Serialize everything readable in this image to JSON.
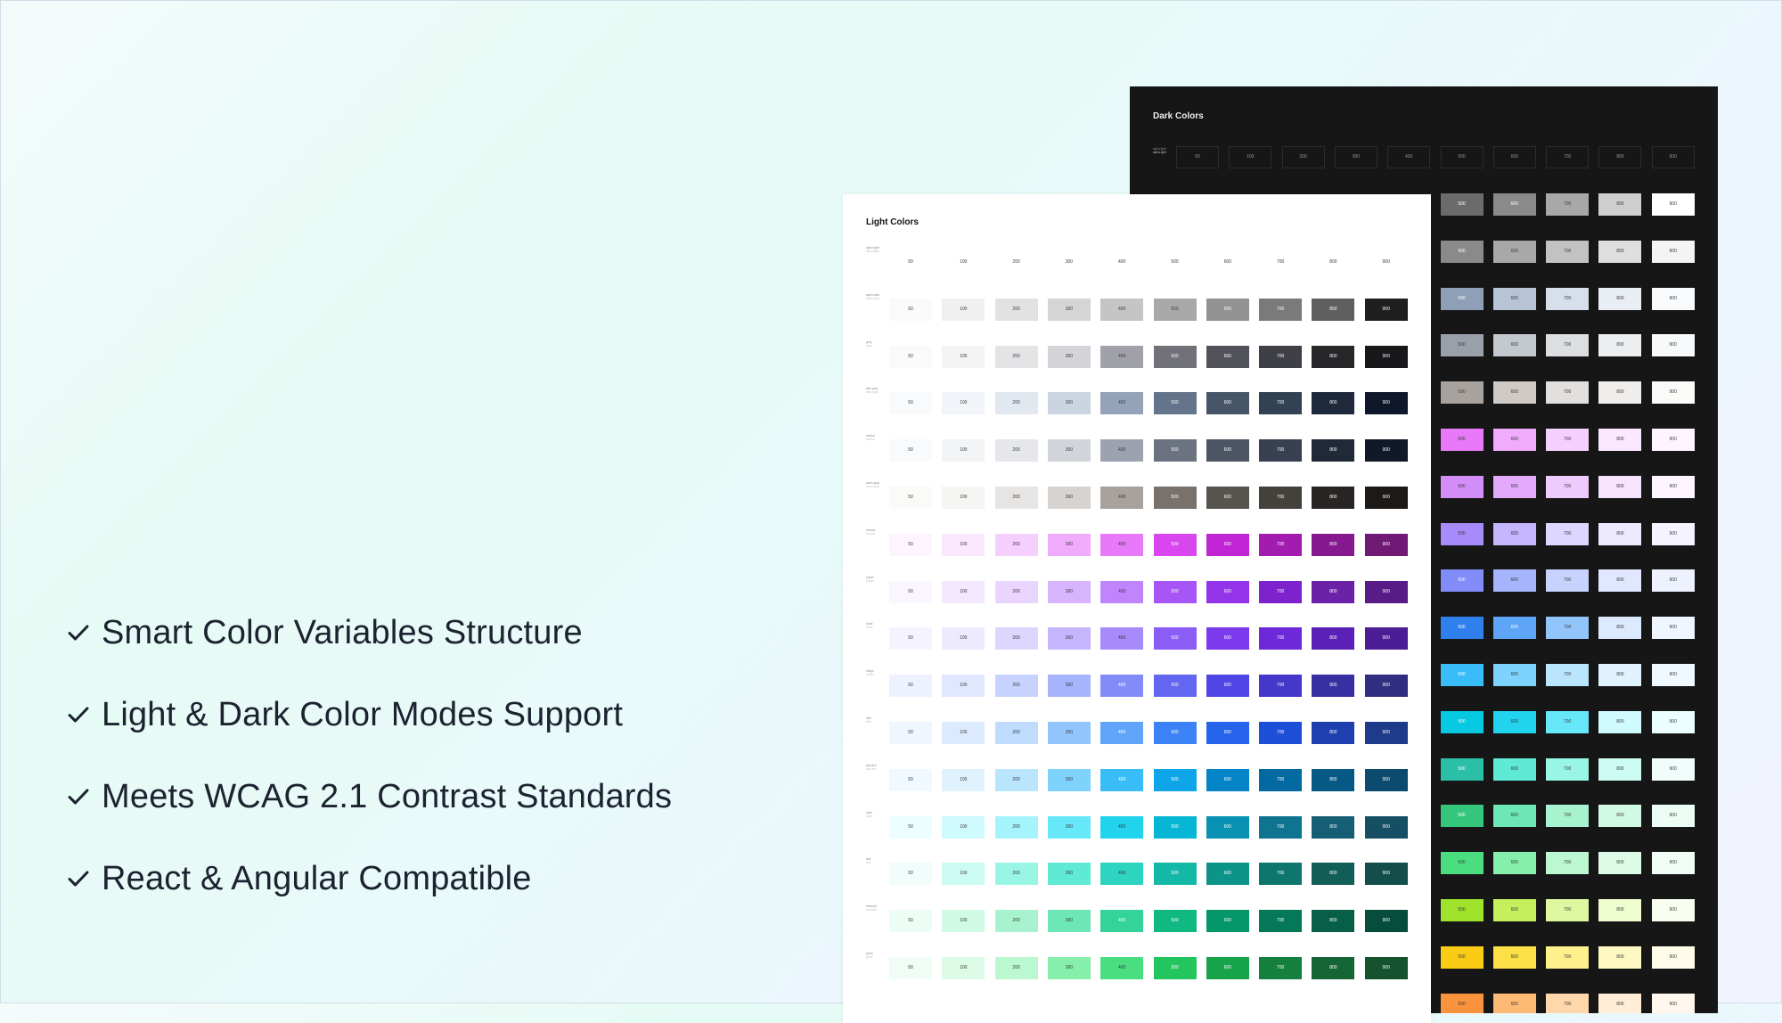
{
  "features": [
    "Smart Color Variables Structure",
    "Light & Dark Color Modes Support",
    "Meets WCAG 2.1 Contrast Standards",
    "React & Angular Compatible"
  ],
  "icons": {
    "feature_icon": "checkmark-icon"
  },
  "colors": {
    "feature_text": "#1c2230",
    "dark_panel_bg": "#161616",
    "light_panel_bg": "#ffffff"
  },
  "light_panel": {
    "title": "Light Colors",
    "rows": [
      {
        "label": "alpha light",
        "sub": "alpha-light",
        "labels": [
          "50",
          "100",
          "200",
          "300",
          "400",
          "500",
          "600",
          "700",
          "800",
          "900"
        ],
        "colors": [
          "#ffffff",
          "#ffffff",
          "#ffffff",
          "#ffffff",
          "#ffffff",
          "#ffffff",
          "#ffffff",
          "#ffffff",
          "#ffffff",
          "#ffffff"
        ]
      },
      {
        "label": "alpha dark",
        "sub": "alpha-dark",
        "labels": [
          "50",
          "100",
          "200",
          "300",
          "400",
          "500",
          "600",
          "700",
          "800",
          "900"
        ],
        "colors": [
          "#fafafa",
          "#f0f0f0",
          "#e2e2e2",
          "#d5d5d5",
          "#c5c5c5",
          "#a9a9a9",
          "#929292",
          "#7a7a7a",
          "#5f5f5f",
          "#1f1f1f"
        ]
      },
      {
        "label": "gray",
        "sub": "gray",
        "labels": [
          "50",
          "100",
          "200",
          "300",
          "400",
          "500",
          "600",
          "700",
          "800",
          "900"
        ],
        "colors": [
          "#fafafa",
          "#f4f4f5",
          "#e4e4e7",
          "#d4d4d8",
          "#a1a1aa",
          "#71717a",
          "#52525b",
          "#3f3f46",
          "#27272a",
          "#18181b"
        ]
      },
      {
        "label": "blue gray",
        "sub": "blue-gray",
        "labels": [
          "50",
          "100",
          "200",
          "300",
          "400",
          "500",
          "600",
          "700",
          "800",
          "900"
        ],
        "colors": [
          "#f8fafc",
          "#f1f5f9",
          "#e2e8f0",
          "#cbd5e1",
          "#94a3b8",
          "#64748b",
          "#475569",
          "#334155",
          "#1e293b",
          "#0f172a"
        ]
      },
      {
        "label": "neutral",
        "sub": "neutral",
        "labels": [
          "50",
          "100",
          "200",
          "300",
          "400",
          "500",
          "600",
          "700",
          "800",
          "900"
        ],
        "colors": [
          "#f9fafb",
          "#f3f4f6",
          "#e5e7eb",
          "#d1d5db",
          "#9ca3af",
          "#6b7280",
          "#4b5563",
          "#374151",
          "#1f2937",
          "#111827"
        ]
      },
      {
        "label": "warm gray",
        "sub": "warm-gray",
        "labels": [
          "50",
          "100",
          "200",
          "300",
          "400",
          "500",
          "600",
          "700",
          "800",
          "900"
        ],
        "colors": [
          "#fafaf9",
          "#f5f5f4",
          "#e7e5e4",
          "#d6d3d1",
          "#a8a29e",
          "#78716c",
          "#57534e",
          "#44403c",
          "#292524",
          "#1c1917"
        ]
      },
      {
        "label": "fuchsia",
        "sub": "fuchsia",
        "labels": [
          "50",
          "100",
          "200",
          "300",
          "400",
          "500",
          "600",
          "700",
          "800",
          "900"
        ],
        "colors": [
          "#fdf4ff",
          "#fae8ff",
          "#f5d0fe",
          "#f0abfc",
          "#e879f9",
          "#d946ef",
          "#c026d3",
          "#a21caf",
          "#86198f",
          "#701a75"
        ]
      },
      {
        "label": "purple",
        "sub": "purple",
        "labels": [
          "50",
          "100",
          "200",
          "300",
          "400",
          "500",
          "600",
          "700",
          "800",
          "900"
        ],
        "colors": [
          "#faf5ff",
          "#f3e8ff",
          "#e9d5ff",
          "#d8b4fe",
          "#c084fc",
          "#a855f7",
          "#9333ea",
          "#7e22ce",
          "#6b21a8",
          "#581c87"
        ]
      },
      {
        "label": "violet",
        "sub": "violet",
        "labels": [
          "50",
          "100",
          "200",
          "300",
          "400",
          "500",
          "600",
          "700",
          "800",
          "900"
        ],
        "colors": [
          "#f5f3ff",
          "#ede9fe",
          "#ddd6fe",
          "#c4b5fd",
          "#a78bfa",
          "#8b5cf6",
          "#7c3aed",
          "#6d28d9",
          "#5b21b6",
          "#4c1d95"
        ]
      },
      {
        "label": "indigo",
        "sub": "indigo",
        "labels": [
          "50",
          "100",
          "200",
          "300",
          "400",
          "500",
          "600",
          "700",
          "800",
          "900"
        ],
        "colors": [
          "#eef2ff",
          "#e0e7ff",
          "#c7d2fe",
          "#a5b4fc",
          "#818cf8",
          "#6366f1",
          "#4f46e5",
          "#4338ca",
          "#3730a3",
          "#312e81"
        ]
      },
      {
        "label": "blue",
        "sub": "blue",
        "labels": [
          "50",
          "100",
          "200",
          "300",
          "400",
          "500",
          "600",
          "700",
          "800",
          "900"
        ],
        "colors": [
          "#eff6ff",
          "#dbeafe",
          "#bfdbfe",
          "#93c5fd",
          "#60a5fa",
          "#3b82f6",
          "#2563eb",
          "#1d4ed8",
          "#1e40af",
          "#1e3a8a"
        ]
      },
      {
        "label": "sky blue",
        "sub": "sky-blue",
        "labels": [
          "50",
          "100",
          "200",
          "300",
          "400",
          "500",
          "600",
          "700",
          "800",
          "900"
        ],
        "colors": [
          "#f0f9ff",
          "#e0f2fe",
          "#bae6fd",
          "#7dd3fc",
          "#38bdf8",
          "#0ea5e9",
          "#0284c7",
          "#0369a1",
          "#075985",
          "#0c4a6e"
        ]
      },
      {
        "label": "cyan",
        "sub": "cyan",
        "labels": [
          "50",
          "100",
          "200",
          "300",
          "400",
          "500",
          "600",
          "700",
          "800",
          "900"
        ],
        "colors": [
          "#ecfeff",
          "#cffafe",
          "#a5f3fc",
          "#67e8f9",
          "#22d3ee",
          "#06b6d4",
          "#0891b2",
          "#0e7490",
          "#155e75",
          "#164e63"
        ]
      },
      {
        "label": "teal",
        "sub": "teal",
        "labels": [
          "50",
          "100",
          "200",
          "300",
          "400",
          "500",
          "600",
          "700",
          "800",
          "900"
        ],
        "colors": [
          "#f0fdfa",
          "#ccfbf1",
          "#99f6e4",
          "#5eead4",
          "#2dd4bf",
          "#14b8a6",
          "#0d9488",
          "#0f766e",
          "#115e59",
          "#134e4a"
        ]
      },
      {
        "label": "emerald",
        "sub": "emerald",
        "labels": [
          "50",
          "100",
          "200",
          "300",
          "400",
          "500",
          "600",
          "700",
          "800",
          "900"
        ],
        "colors": [
          "#ecfdf5",
          "#d1fae5",
          "#a7f3d0",
          "#6ee7b7",
          "#34d399",
          "#10b981",
          "#059669",
          "#047857",
          "#065f46",
          "#064e3b"
        ]
      },
      {
        "label": "green",
        "sub": "green",
        "labels": [
          "50",
          "100",
          "200",
          "300",
          "400",
          "500",
          "600",
          "700",
          "800",
          "900"
        ],
        "colors": [
          "#f0fdf4",
          "#dcfce7",
          "#bbf7d0",
          "#86efac",
          "#4ade80",
          "#22c55e",
          "#16a34a",
          "#15803d",
          "#166534",
          "#14532d"
        ]
      }
    ]
  },
  "dark_panel": {
    "title": "Dark Colors",
    "header_row": {
      "label": "alpha light",
      "sub": "alpha-light",
      "labels": [
        "50",
        "100",
        "200",
        "300",
        "400",
        "500",
        "600",
        "700",
        "800",
        "900"
      ]
    },
    "rows": [
      {
        "labels": [
          "500",
          "600",
          "700",
          "800",
          "900"
        ],
        "colors": [
          "#6b6b6b",
          "#8a8a8a",
          "#a8a8a8",
          "#cfcfcf",
          "#ffffff"
        ]
      },
      {
        "labels": [
          "500",
          "600",
          "700",
          "800",
          "900"
        ],
        "colors": [
          "#8a8a8a",
          "#a8a8a8",
          "#c2c2c2",
          "#dedede",
          "#f4f4f4"
        ]
      },
      {
        "labels": [
          "500",
          "600",
          "700",
          "800",
          "900"
        ],
        "colors": [
          "#8da0b8",
          "#b6c4d6",
          "#d6dfea",
          "#e9eef5",
          "#f8fafc"
        ]
      },
      {
        "labels": [
          "500",
          "600",
          "700",
          "800",
          "900"
        ],
        "colors": [
          "#9aa0aa",
          "#c4c8cf",
          "#dcdee2",
          "#eceef0",
          "#f8f9fa"
        ]
      },
      {
        "labels": [
          "500",
          "600",
          "700",
          "800",
          "900"
        ],
        "colors": [
          "#a8a29e",
          "#cfcac6",
          "#e2dfdc",
          "#f0eeec",
          "#fafaf9"
        ]
      },
      {
        "labels": [
          "500",
          "600",
          "700",
          "800",
          "900"
        ],
        "colors": [
          "#e879f9",
          "#f0abfc",
          "#f5d0fe",
          "#fae8ff",
          "#fdf4ff"
        ]
      },
      {
        "labels": [
          "500",
          "600",
          "700",
          "800",
          "900"
        ],
        "colors": [
          "#d38df9",
          "#e3aafc",
          "#efcbfd",
          "#f6e3fe",
          "#fcf5ff"
        ]
      },
      {
        "labels": [
          "500",
          "600",
          "700",
          "800",
          "900"
        ],
        "colors": [
          "#a78bfa",
          "#c4b5fd",
          "#ddd6fe",
          "#ede9fe",
          "#f5f3ff"
        ]
      },
      {
        "labels": [
          "500",
          "600",
          "700",
          "800",
          "900"
        ],
        "colors": [
          "#818cf8",
          "#a5b4fc",
          "#c7d2fe",
          "#e0e7ff",
          "#eef2ff"
        ]
      },
      {
        "labels": [
          "500",
          "600",
          "700",
          "800",
          "900"
        ],
        "colors": [
          "#2f80ed",
          "#5ea4f7",
          "#93c5fd",
          "#dbeafe",
          "#eff6ff"
        ]
      },
      {
        "labels": [
          "500",
          "600",
          "700",
          "800",
          "900"
        ],
        "colors": [
          "#38bdf8",
          "#7dd3fc",
          "#bae6fd",
          "#e0f2fe",
          "#f0f9ff"
        ]
      },
      {
        "labels": [
          "500",
          "600",
          "700",
          "800",
          "900"
        ],
        "colors": [
          "#06c8e0",
          "#22d3ee",
          "#67e8f9",
          "#cffafe",
          "#ecfeff"
        ]
      },
      {
        "labels": [
          "500",
          "600",
          "700",
          "800",
          "900"
        ],
        "colors": [
          "#2bbfa8",
          "#5eead4",
          "#99f6e4",
          "#ccfbf1",
          "#f0fdfa"
        ]
      },
      {
        "labels": [
          "500",
          "600",
          "700",
          "800",
          "900"
        ],
        "colors": [
          "#34c77b",
          "#6ee7b7",
          "#a7f3d0",
          "#d1fae5",
          "#ecfdf5"
        ]
      },
      {
        "labels": [
          "500",
          "600",
          "700",
          "800",
          "900"
        ],
        "colors": [
          "#4ade80",
          "#86efac",
          "#bbf7d0",
          "#dcfce7",
          "#f0fdf4"
        ]
      },
      {
        "labels": [
          "500",
          "600",
          "700",
          "800",
          "900"
        ],
        "colors": [
          "#9ee22c",
          "#c4f05e",
          "#def7a0",
          "#eefcd0",
          "#f8fef0"
        ]
      },
      {
        "labels": [
          "500",
          "600",
          "700",
          "800",
          "900"
        ],
        "colors": [
          "#facc15",
          "#fde047",
          "#fef08a",
          "#fef9c3",
          "#fefce8"
        ]
      },
      {
        "labels": [
          "500",
          "600",
          "700",
          "800",
          "900"
        ],
        "colors": [
          "#fb923c",
          "#fdba74",
          "#fed7aa",
          "#ffedd5",
          "#fff7ed"
        ]
      }
    ]
  }
}
